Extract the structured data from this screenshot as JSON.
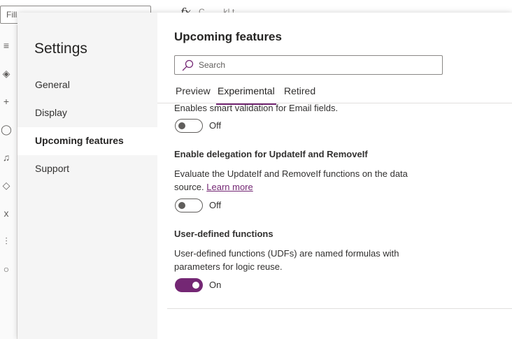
{
  "background": {
    "fill_property": "Fill",
    "formula_fx": "fx",
    "formula_text": "C ... ...k! t ...",
    "rail_icons": [
      "hamburger-icon",
      "layers-icon",
      "plus-icon",
      "database-icon",
      "media-icon",
      "tags-icon",
      "variables-icon",
      "tools-icon",
      "search-icon"
    ]
  },
  "settings": {
    "title": "Settings",
    "nav": [
      {
        "label": "General"
      },
      {
        "label": "Display"
      },
      {
        "label": "Upcoming features",
        "active": true
      },
      {
        "label": "Support"
      }
    ]
  },
  "upcoming": {
    "title": "Upcoming features",
    "search_placeholder": "Search",
    "tabs": [
      {
        "label": "Preview"
      },
      {
        "label": "Experimental",
        "active": true
      },
      {
        "label": "Retired"
      }
    ],
    "features": [
      {
        "description": "Enables smart validation for Email fields.",
        "toggle_state": "off",
        "toggle_label": "Off"
      },
      {
        "title": "Enable delegation for UpdateIf and RemoveIf",
        "description_line1": "Evaluate the UpdateIf and RemoveIf functions on the data",
        "description_line2": "source.",
        "link_text": "Learn more",
        "toggle_state": "off",
        "toggle_label": "Off"
      },
      {
        "title": "User-defined functions",
        "description_line1": "User-defined functions (UDFs) are named formulas with",
        "description_line2": "parameters for logic reuse.",
        "toggle_state": "on",
        "toggle_label": "On"
      }
    ]
  },
  "colors": {
    "accent": "#742774",
    "nav_background": "#f5f5f5",
    "text": "#323130"
  }
}
